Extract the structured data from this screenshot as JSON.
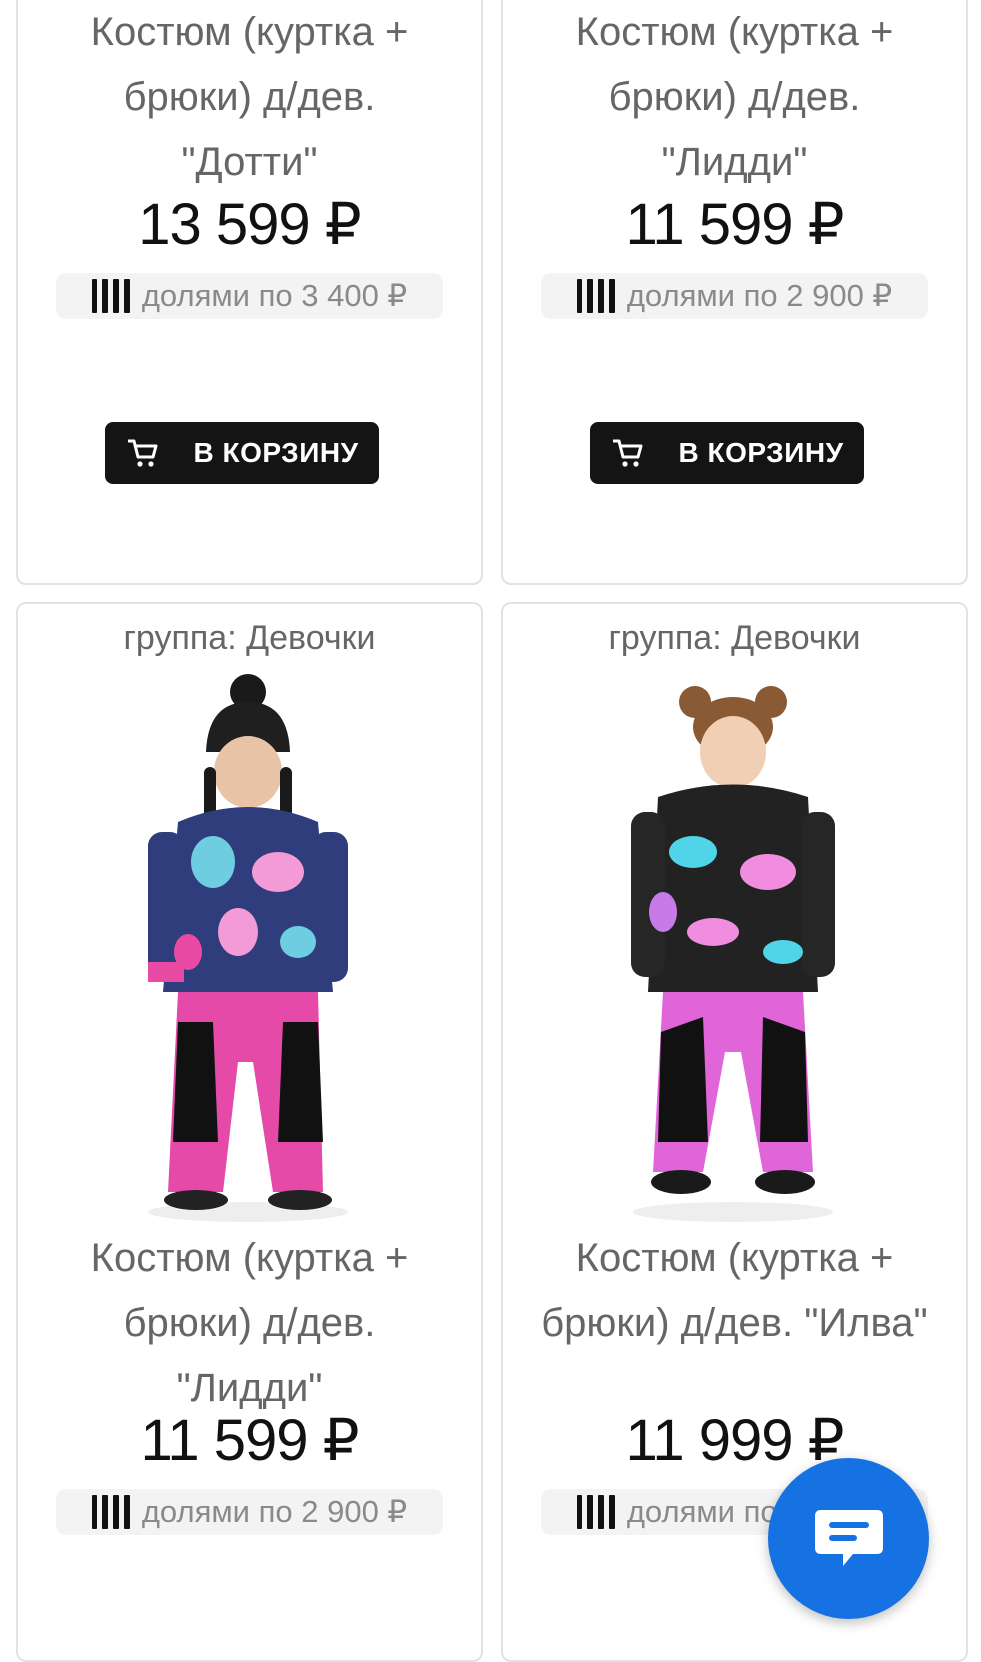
{
  "products": [
    {
      "title_lines": [
        "Костюм (куртка +",
        "брюки) д/дев.",
        "\"Дотти\""
      ],
      "price": "13 599 ₽",
      "installments": "долями по 3 400 ₽",
      "cart_label": "В КОРЗИНУ"
    },
    {
      "title_lines": [
        "Костюм (куртка +",
        "брюки) д/дев.",
        "\"Лидди\""
      ],
      "price": "11 599 ₽",
      "installments": "долями по 2 900 ₽",
      "cart_label": "В КОРЗИНУ"
    },
    {
      "group": "группа: Девочки",
      "title_lines": [
        "Костюм (куртка +",
        "брюки) д/дев.",
        "\"Лидди\""
      ],
      "price": "11 599 ₽",
      "installments": "долями по 2 900 ₽"
    },
    {
      "group": "группа: Девочки",
      "title_lines": [
        "Костюм (куртка +",
        "брюки) д/дев. \"Илва\""
      ],
      "price": "11 999 ₽",
      "installments": "долями по 3 000 ₽"
    }
  ],
  "icons": {
    "cart": "shopping-cart-icon",
    "installments": "installment-bars-icon",
    "chat": "chat-bubble-icon"
  },
  "colors": {
    "accent": "#1672e3",
    "button_dark": "#141414",
    "pants_pink": "#e64aa9"
  }
}
